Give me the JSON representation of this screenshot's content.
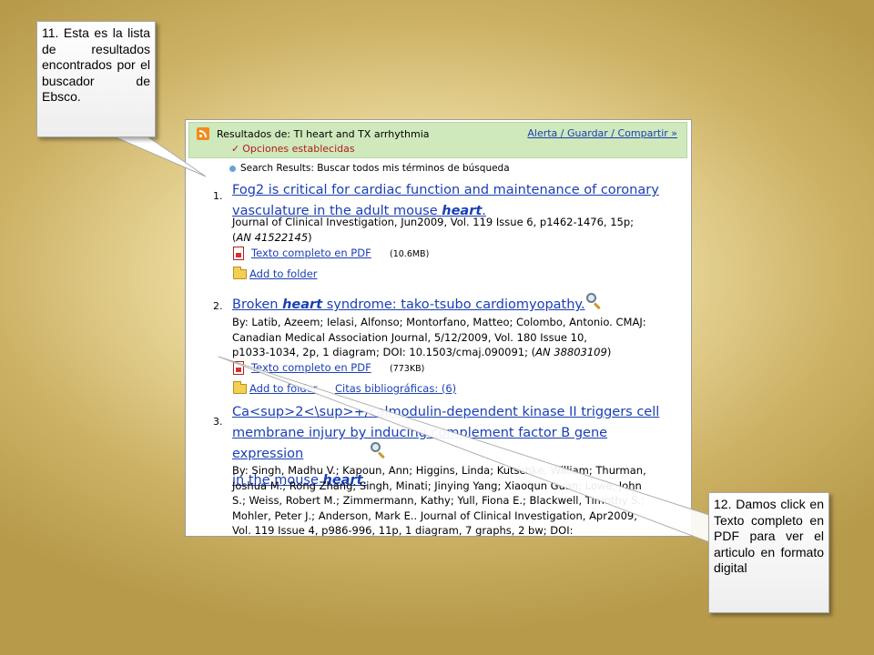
{
  "callouts": {
    "first": "11. Esta es la lista de resultados encontrados por el buscador de Ebsco.",
    "second": "12. Damos click en Texto completo en PDF para ver el articulo en formato digital"
  },
  "header": {
    "title": "Resultados de: TI heart and TX arrhythmia",
    "links": "Alerta / Guardar / Compartir »",
    "options": "Opciones establecidas"
  },
  "search_line": "Search Results: Buscar todos mis términos de búsqueda",
  "results": [
    {
      "num": "1.",
      "title_line1": "Fog2 is critical for cardiac function and maintenance of coronary",
      "title_line2": "vasculature in the adult mouse ",
      "title_italic": "heart",
      "title_tail": ".",
      "meta_line1": "Journal of Clinical Investigation, Jun2009, Vol. 119 Issue 6, p1462-1476, 15p;",
      "meta_line2_pre": "(",
      "meta_line2_an": "AN 41522145",
      "meta_line2_post": ")",
      "pdf_label": "Texto completo en PDF",
      "pdf_size": "(10.6MB)",
      "folder_label": "Add to folder"
    },
    {
      "num": "2.",
      "title_pre": "Broken ",
      "title_italic": "heart",
      "title_post": " syndrome: tako-tsubo cardiomyopathy.",
      "meta_line1": "By: Latib, Azeem; Ielasi, Alfonso; Montorfano, Matteo; Colombo, Antonio. CMAJ:",
      "meta_line2": "Canadian Medical Association Journal, 5/12/2009, Vol. 180 Issue 10,",
      "meta_line3_pre": "p1033-1034, 2p, 1 diagram; DOI: 10.1503/cmaj.090091; (",
      "meta_line3_an": "AN 38803109",
      "meta_line3_post": ")",
      "pdf_label": "Texto completo en PDF",
      "pdf_size": "(773KB)",
      "folder_label": "Add to folder",
      "citations_label": "Citas bibliográficas: (6)"
    },
    {
      "num": "3.",
      "title_line1": "Ca<sup>2<\\sup>+/calmodulin-dependent kinase II triggers cell",
      "title_line2": "membrane injury by inducing complement factor B gene expression",
      "title_line3_pre": "in the mouse ",
      "title_italic": "heart",
      "title_tail": ".",
      "meta_line1": "By: Singh, Madhu V.; Kapoun, Ann; Higgins, Linda; Kutschke, William; Thurman,",
      "meta_line2": "Joshua M.; Rong Zhang; Singh, Minati; Jinying Yang; Xiaoqun Guan; Lowe, John",
      "meta_line3": "S.; Weiss, Robert M.; Zimmermann, Kathy; Yull, Fiona E.; Blackwell, Timothy S.;",
      "meta_line4": "Mohler, Peter J.; Anderson, Mark E.. Journal of Clinical Investigation, Apr2009,",
      "meta_line5": "Vol. 119 Issue 4, p986-996, 11p, 1 diagram, 7 graphs, 2 bw; DOI:"
    }
  ]
}
